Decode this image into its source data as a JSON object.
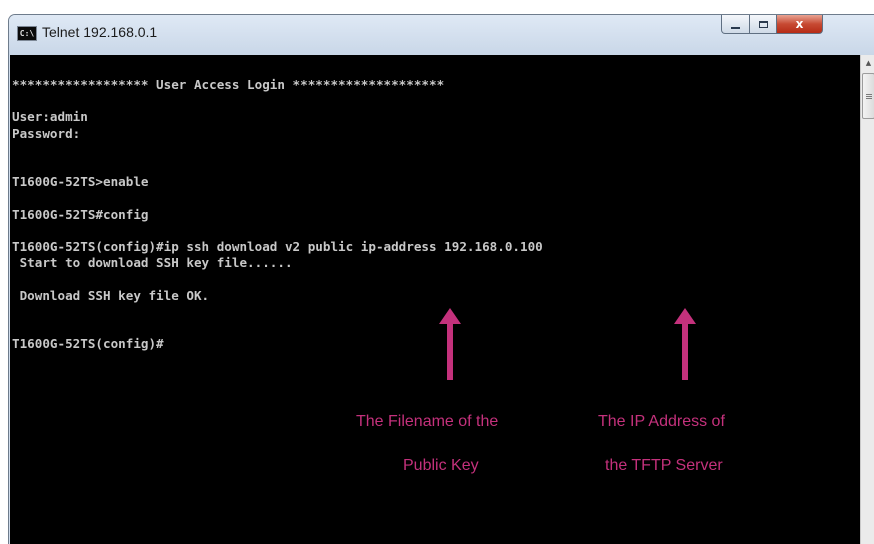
{
  "window": {
    "title": "Telnet 192.168.0.1",
    "icon": "console-icon",
    "icon_text": "C:\\",
    "controls": {
      "minimize": "minimize-icon",
      "maximize": "maximize-icon",
      "close": "close-icon",
      "close_glyph": "x"
    }
  },
  "terminal": {
    "lines": [
      "****************** User Access Login ********************",
      "",
      "User:admin",
      "Password:",
      "",
      "",
      "T1600G-52TS>enable",
      "",
      "T1600G-52TS#config",
      "",
      "T1600G-52TS(config)#ip ssh download v2 public ip-address 192.168.0.100",
      " Start to download SSH key file......",
      "",
      " Download SSH key file OK.",
      "",
      "",
      "T1600G-52TS(config)#"
    ]
  },
  "annotations": {
    "filename": {
      "line1": "The Filename of the",
      "line2": "Public Key"
    },
    "ip_address": {
      "line1": "The IP Address of",
      "line2": "the TFTP Server"
    },
    "accent": "#c4317c"
  },
  "scrollbar": {
    "up_arrow": "scroll-up-icon"
  }
}
